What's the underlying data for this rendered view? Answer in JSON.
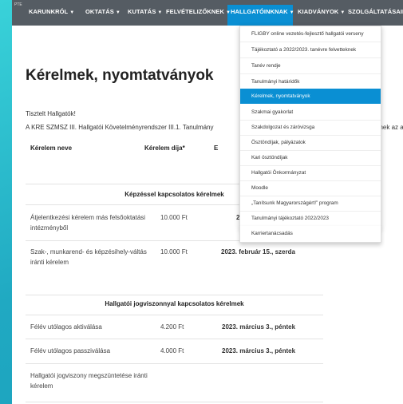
{
  "nav": {
    "logo_text": "PTE",
    "items": [
      {
        "label": "KARUNKRÓL"
      },
      {
        "label": "OKTATÁS"
      },
      {
        "label": "KUTATÁS"
      },
      {
        "label": "FELVÉTELIZŐKNEK"
      },
      {
        "label": "HALLGATÓINKNAK"
      },
      {
        "label": "KIADVÁNYOK"
      },
      {
        "label": "SZOLGÁLTATÁSAINK"
      }
    ]
  },
  "dropdown": {
    "items": [
      {
        "label": "FLIGBY online vezetés-fejlesztő hallgatói verseny"
      },
      {
        "label": "Tájékoztató a 2022/2023. tanévre felvetteknek"
      },
      {
        "label": "Tanév rendje"
      },
      {
        "label": "Tanulmányi határidők"
      },
      {
        "label": "Kérelmek, nyomtatványok"
      },
      {
        "label": "Szakmai gyakorlat"
      },
      {
        "label": "Szakdolgozat és záróvizsga"
      },
      {
        "label": "Ösztöndíjak, pályázatok"
      },
      {
        "label": "Kari ösztöndíjak"
      },
      {
        "label": "Hallgatói Önkormányzat"
      },
      {
        "label": "Moodle"
      },
      {
        "label": "„Tanítsunk Magyarországért!” program"
      },
      {
        "label": "Tanulmányi tájékoztató 2022/2023"
      },
      {
        "label": "Karriertanácsadás"
      }
    ],
    "active_index": 4
  },
  "content": {
    "title": "Kérelmek, nyomtatványok",
    "greeting": "Tisztelt Hallgatók!",
    "intro": "A KRE SZMSZ III. Hallgatói Követelményrendszer III.1. Tanulmány",
    "intro_tail": "elmek az al",
    "columns": [
      "Kérelem neve",
      "Kérelem díja*",
      "E"
    ],
    "section1": "Képzéssel kapcsolatos kérelmek",
    "section2": "Hallgatói jogviszonnyal kapcsolatos kérelmek",
    "rows": [
      {
        "name": "Átjelentkezési kérelem más felsőoktatási intézményből",
        "fee": "10.000 Ft",
        "deadline": "2"
      },
      {
        "name": "Szak-, munkarend- és képzésihely-váltás iránti kérelem",
        "fee": "10.000 Ft",
        "deadline": "2023. február 15., szerda"
      },
      {
        "name": "Félév utólagos aktiválása",
        "fee": "4.200 Ft",
        "deadline": "2023. március 3., péntek"
      },
      {
        "name": "Félév utólagos passziválása",
        "fee": "4.000 Ft",
        "deadline": "2023. március 3., péntek"
      },
      {
        "name": "Hallgatói jogviszony megszüntetése iránti kérelem",
        "fee": "",
        "deadline": ""
      }
    ]
  },
  "colors": {
    "accent": "#0a8fd3",
    "nav_bg": "#555c63",
    "frame": "#2ab9c9"
  }
}
